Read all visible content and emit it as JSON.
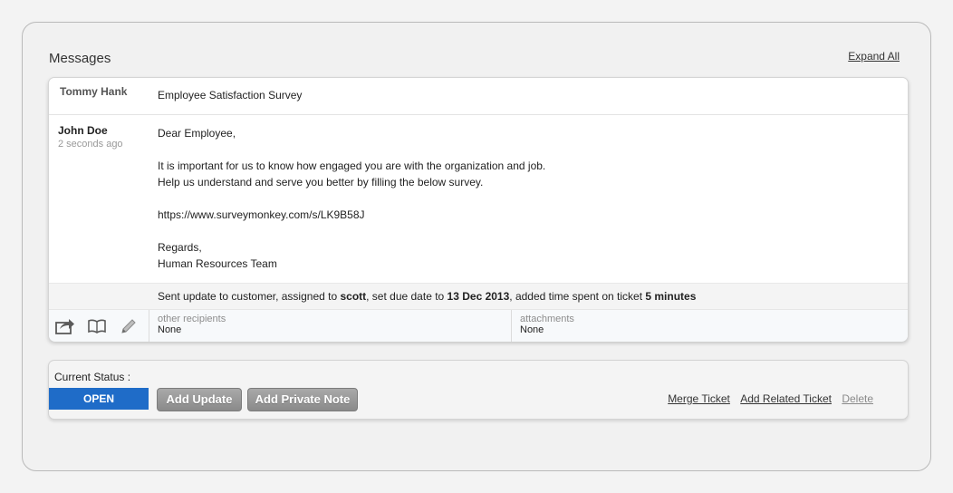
{
  "messages": {
    "title": "Messages",
    "expand_all": "Expand All",
    "first": {
      "author": "Tommy Hank",
      "subject": "Employee Satisfaction Survey"
    },
    "second": {
      "author": "John Doe",
      "time": "2 seconds ago",
      "body": [
        "Dear Employee,",
        "",
        "It is important for us to know how engaged you are with the organization and job.",
        "Help us understand and serve you better by filling the below survey.",
        "",
        "https://www.surveymonkey.com/s/LK9B58J",
        "",
        "Regards,",
        "Human Resources Team"
      ]
    },
    "activity": {
      "part1": "Sent update to customer, assigned to ",
      "assignee": "scott",
      "part2": ", set due date to ",
      "due": "13 Dec 2013",
      "part3": ", added time spent on ticket ",
      "time_spent": "5 minutes"
    },
    "footer": {
      "icons": [
        "forward-icon",
        "book-icon",
        "pencil-icon"
      ],
      "recipients_label": "other recipients",
      "recipients_value": "None",
      "attachments_label": "attachments",
      "attachments_value": "None"
    }
  },
  "status": {
    "label": "Current Status :",
    "value": "OPEN",
    "color": "#1f6cc8",
    "add_update": "Add Update",
    "add_private_note": "Add Private Note",
    "merge_ticket": "Merge Ticket",
    "add_related_ticket": "Add Related Ticket",
    "delete": "Delete"
  }
}
